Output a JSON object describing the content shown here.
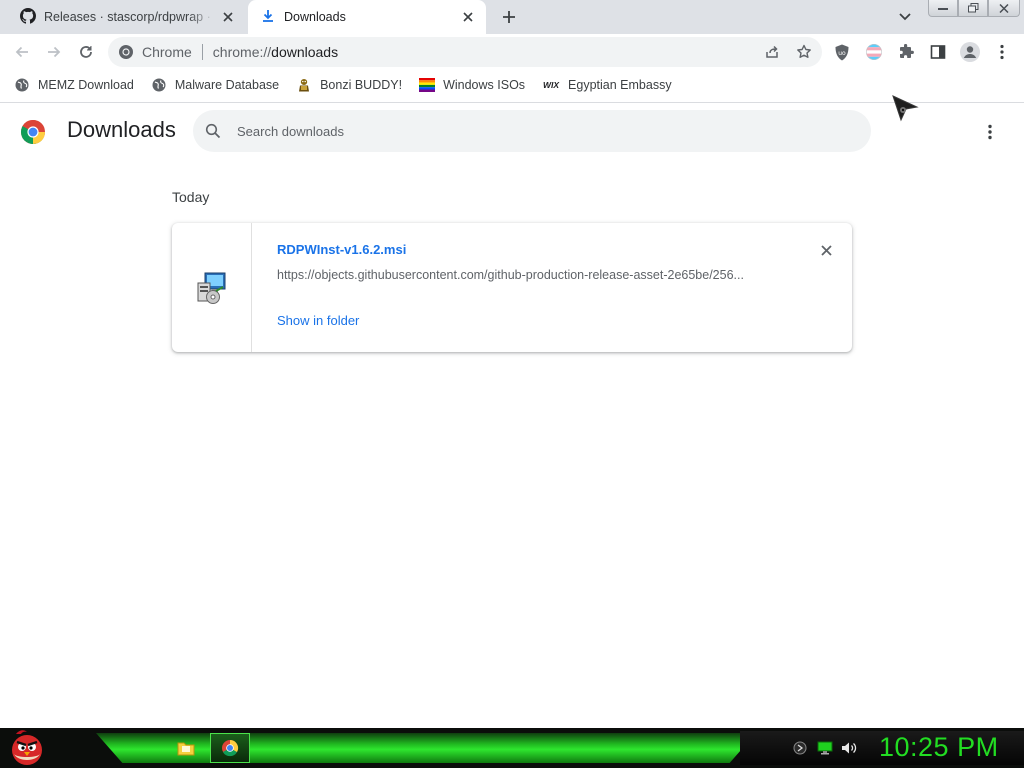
{
  "browser": {
    "tabs": [
      {
        "title": "Releases · stascorp/rdpwrap · GitHub",
        "favicon": "github-icon",
        "active": false
      },
      {
        "title": "Downloads",
        "favicon": "download-icon",
        "active": true
      }
    ],
    "omnibox": {
      "site_label": "Chrome",
      "url_scheme": "chrome://",
      "url_host": "downloads"
    },
    "bookmarks": [
      {
        "label": "MEMZ Download",
        "icon": "globe-icon"
      },
      {
        "label": "Malware Database",
        "icon": "globe-icon"
      },
      {
        "label": "Bonzi BUDDY!",
        "icon": "bonzi-icon"
      },
      {
        "label": "Windows ISOs",
        "icon": "windows-flag-icon"
      },
      {
        "label": "Egyptian Embassy",
        "icon": "wix-icon"
      }
    ],
    "wix_text": "WIX"
  },
  "downloads_page": {
    "title": "Downloads",
    "search_placeholder": "Search downloads",
    "section_date": "Today",
    "items": [
      {
        "file_name": "RDPWInst-v1.6.2.msi",
        "url": "https://objects.githubusercontent.com/github-production-release-asset-2e65be/256...",
        "action_label": "Show in folder",
        "icon": "msi-installer-icon"
      }
    ]
  },
  "taskbar": {
    "clock": "10:25 PM",
    "apps": [
      "file-explorer-icon",
      "chrome-icon"
    ]
  },
  "colors": {
    "accent": "#1a73e8",
    "tabstrip": "#dee1e6",
    "clock": "#22dd22"
  }
}
